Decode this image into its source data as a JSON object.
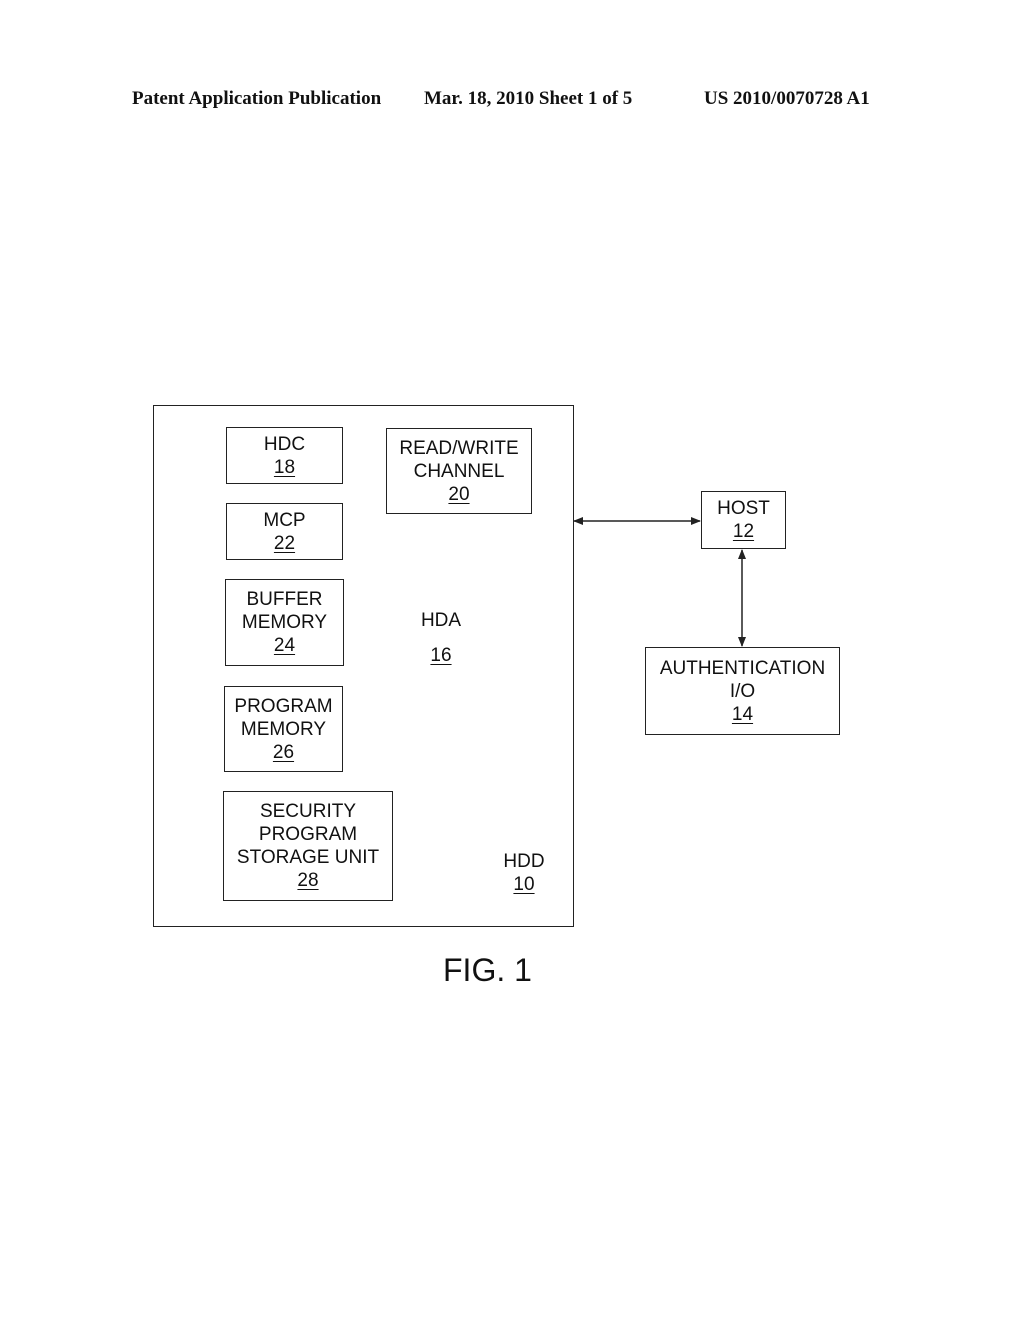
{
  "header": {
    "publication": "Patent Application Publication",
    "date_sheet": "Mar. 18, 2010  Sheet 1 of 5",
    "number": "US 2010/0070728 A1"
  },
  "diagram": {
    "hdd": {
      "label": "HDD",
      "ref": "10"
    },
    "hdc": {
      "label": "HDC",
      "ref": "18"
    },
    "rw_channel": {
      "line1": "READ/WRITE",
      "line2": "CHANNEL",
      "ref": "20"
    },
    "mcp": {
      "label": "MCP",
      "ref": "22"
    },
    "buffer_memory": {
      "line1": "BUFFER",
      "line2": "MEMORY",
      "ref": "24"
    },
    "hda": {
      "label": "HDA",
      "ref": "16"
    },
    "program_memory": {
      "line1": "PROGRAM",
      "line2": "MEMORY",
      "ref": "26"
    },
    "security_storage": {
      "line1": "SECURITY",
      "line2": "PROGRAM",
      "line3": "STORAGE UNIT",
      "ref": "28"
    },
    "host": {
      "label": "HOST",
      "ref": "12"
    },
    "auth_io": {
      "line1": "AUTHENTICATION",
      "line2": "I/O",
      "ref": "14"
    },
    "connections": [
      {
        "from": "HDD 10",
        "to": "HOST 12",
        "type": "bidirectional"
      },
      {
        "from": "HOST 12",
        "to": "AUTHENTICATION I/O 14",
        "type": "bidirectional"
      }
    ]
  },
  "figure_caption": "FIG. 1"
}
